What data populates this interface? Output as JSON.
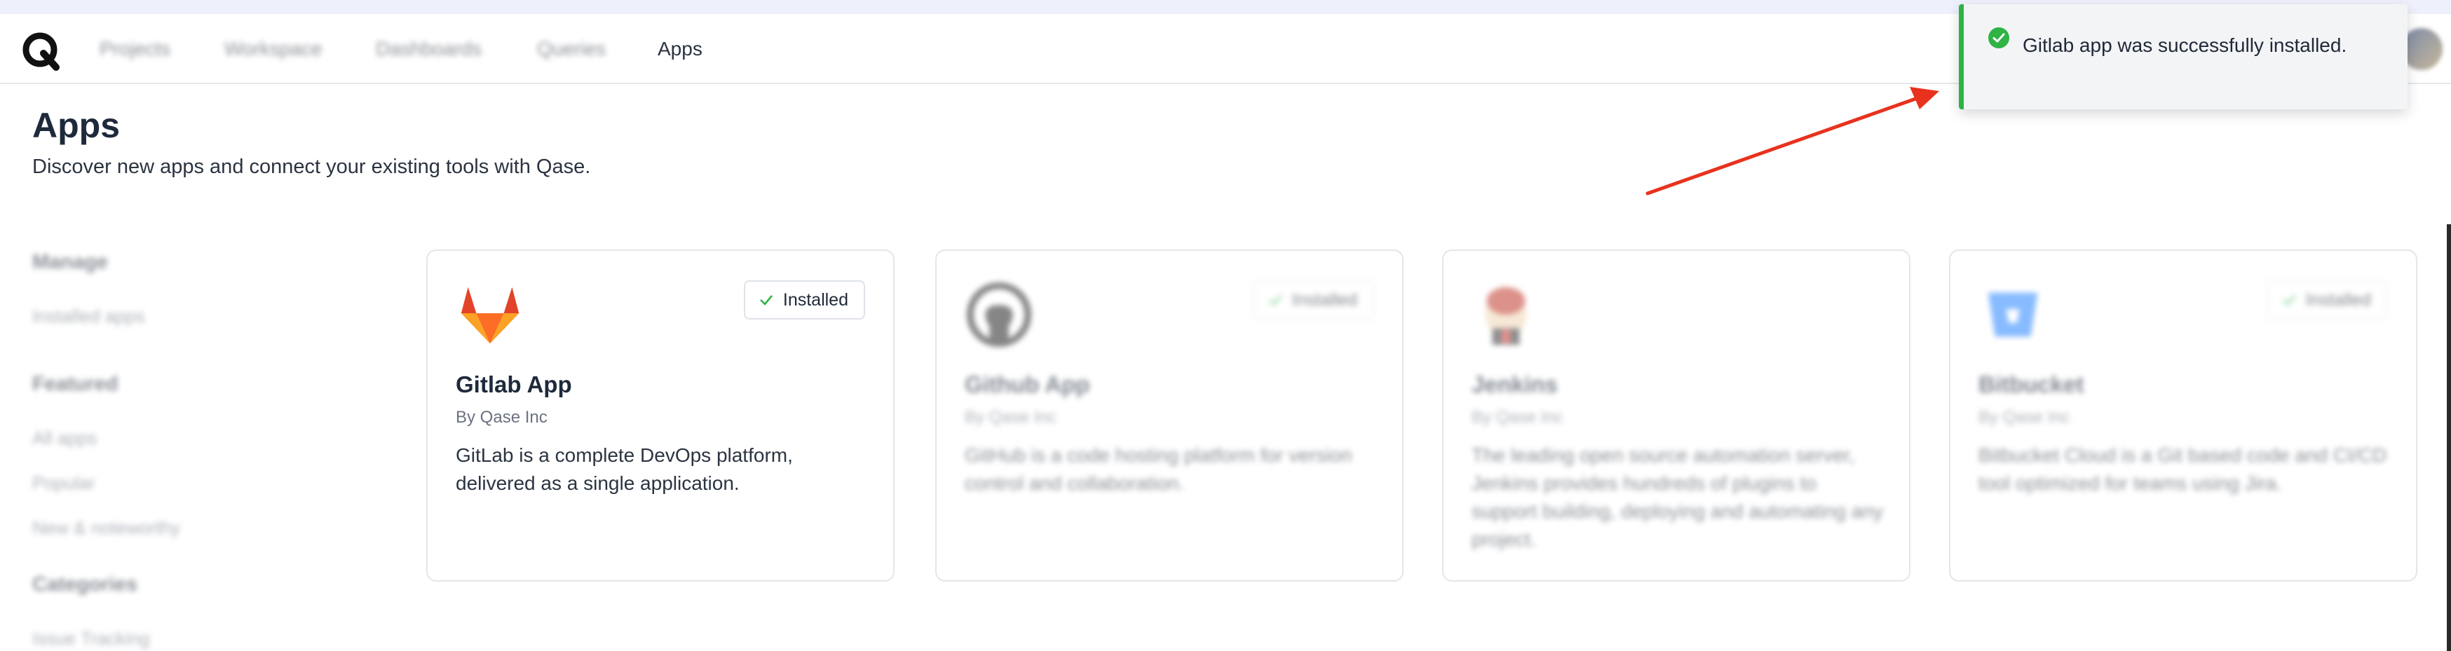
{
  "nav": {
    "logo_icon": "qase-logo-icon",
    "items": [
      {
        "label": "Projects"
      },
      {
        "label": "Workspace"
      },
      {
        "label": "Dashboards"
      },
      {
        "label": "Queries"
      },
      {
        "label": "Apps"
      }
    ],
    "active": "Apps"
  },
  "page": {
    "title": "Apps",
    "subtitle": "Discover new apps and connect your existing tools with Qase."
  },
  "sidebar": {
    "sections": [
      {
        "heading": "Manage",
        "items": [
          "Installed apps"
        ]
      },
      {
        "heading": "Featured",
        "items": [
          "All apps",
          "Popular",
          "New & noteworthy"
        ]
      },
      {
        "heading": "Categories",
        "items": [
          "Issue Tracking"
        ]
      }
    ]
  },
  "apps": [
    {
      "name": "Gitlab App",
      "vendor": "By Qase Inc",
      "description": "GitLab is a complete DevOps platform, delivered as a single application.",
      "badge": "Installed",
      "icon": "gitlab-icon"
    },
    {
      "name": "Github App",
      "vendor": "By Qase Inc",
      "description": "GitHub is a code hosting platform for version control and collaboration.",
      "badge": "Installed",
      "icon": "github-icon"
    },
    {
      "name": "Jenkins",
      "vendor": "By Qase Inc",
      "description": "The leading open source automation server, Jenkins provides hundreds of plugins to support building, deploying and automating any project.",
      "icon": "jenkins-icon"
    },
    {
      "name": "Bitbucket",
      "vendor": "By Qase Inc",
      "description": "Bitbucket Cloud is a Git based code and CI/CD tool optimized for teams using Jira.",
      "badge": "Installed",
      "icon": "bitbucket-icon"
    }
  ],
  "toast": {
    "message": "Gitlab app was successfully installed.",
    "icon": "success-check-icon",
    "accent_color": "#2fb344"
  },
  "annotation": {
    "arrow_color": "#e8321e"
  }
}
